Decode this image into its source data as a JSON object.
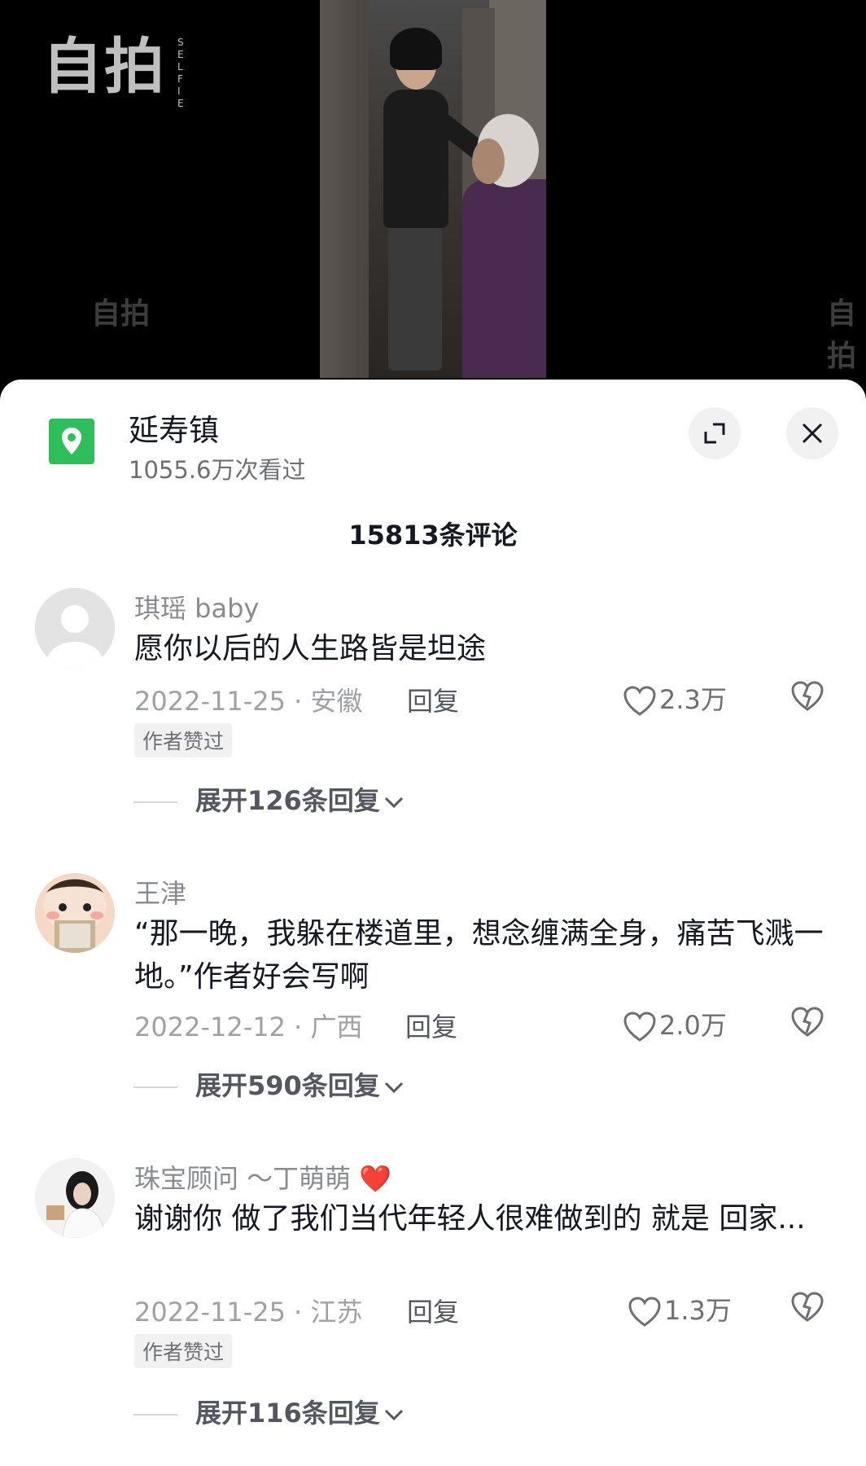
{
  "video": {
    "logo_text": "自拍",
    "logo_sub": "SELFIE",
    "watermark_left": "自拍",
    "watermark_right": "自拍"
  },
  "location": {
    "icon": "location-pin-icon",
    "title": "延寿镇",
    "views": "1055.6万次看过",
    "accent": "#2fbf5a"
  },
  "comments_header": {
    "count_label": "15813条评论"
  },
  "comments": [
    {
      "name": "琪瑶 baby",
      "text": "愿你以后的人生路皆是坦途",
      "date": "2022-11-25",
      "region": "安徽",
      "reply_label": "回复",
      "likes": "2.3万",
      "badge": "作者赞过",
      "expand_label": "展开126条回复"
    },
    {
      "name": "王津",
      "text": "“那一晚，我躲在楼道里，想念缠满全身，痛苦飞溅一地。”作者好会写啊",
      "date": "2022-12-12",
      "region": "广西",
      "reply_label": "回复",
      "likes": "2.0万",
      "expand_label": "展开590条回复"
    },
    {
      "name": "珠宝顾问 ～丁萌萌",
      "name_emoji": "❤️",
      "text": "谢谢你 做了我们当代年轻人很难做到的 就是 回家...",
      "date": "2022-11-25",
      "region": "江苏",
      "reply_label": "回复",
      "likes": "1.3万",
      "badge": "作者赞过",
      "expand_label": "展开116条回复"
    }
  ]
}
